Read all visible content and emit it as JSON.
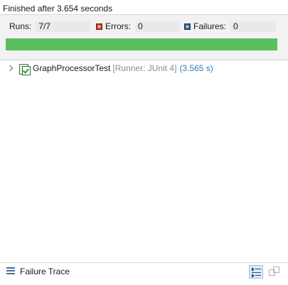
{
  "status": {
    "text": "Finished after 3.654 seconds"
  },
  "counters": {
    "runs_label": "Runs:",
    "runs_value": "7/7",
    "errors_label": "Errors:",
    "errors_value": "0",
    "failures_label": "Failures:",
    "failures_value": "0",
    "error_icon": "error-icon",
    "failure_icon": "failure-icon"
  },
  "progress": {
    "fraction": 1.0,
    "color": "#5cbf5f"
  },
  "tree": {
    "items": [
      {
        "name": "GraphProcessorTest",
        "runner": "[Runner: JUnit 4]",
        "time": "(3.565 s)",
        "icon": "test-suite-passed-icon",
        "expanded": false
      }
    ]
  },
  "footer": {
    "title": "Failure Trace",
    "menu_icon": "list-icon",
    "filter_icon": "filter-stack-trace-icon",
    "compare_icon": "compare-results-icon"
  }
}
